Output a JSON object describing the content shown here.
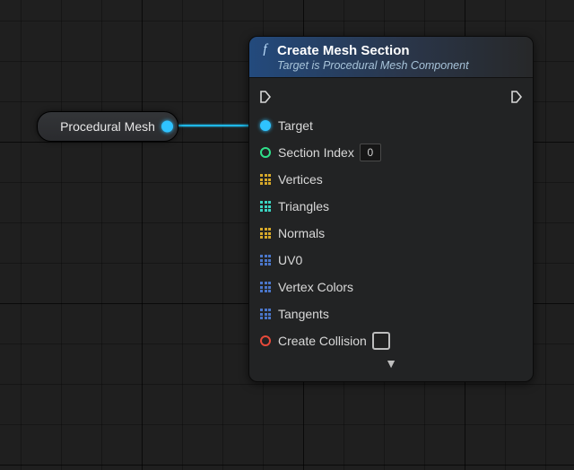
{
  "var_node": {
    "label": "Procedural Mesh"
  },
  "func_node": {
    "title": "Create Mesh Section",
    "subtitle": "Target is Procedural Mesh Component",
    "pins": {
      "target": "Target",
      "section_index": "Section Index",
      "section_index_value": "0",
      "vertices": "Vertices",
      "triangles": "Triangles",
      "normals": "Normals",
      "uv0": "UV0",
      "vertex_colors": "Vertex Colors",
      "tangents": "Tangents",
      "create_collision": "Create Collision"
    },
    "expand_glyph": "▼"
  }
}
